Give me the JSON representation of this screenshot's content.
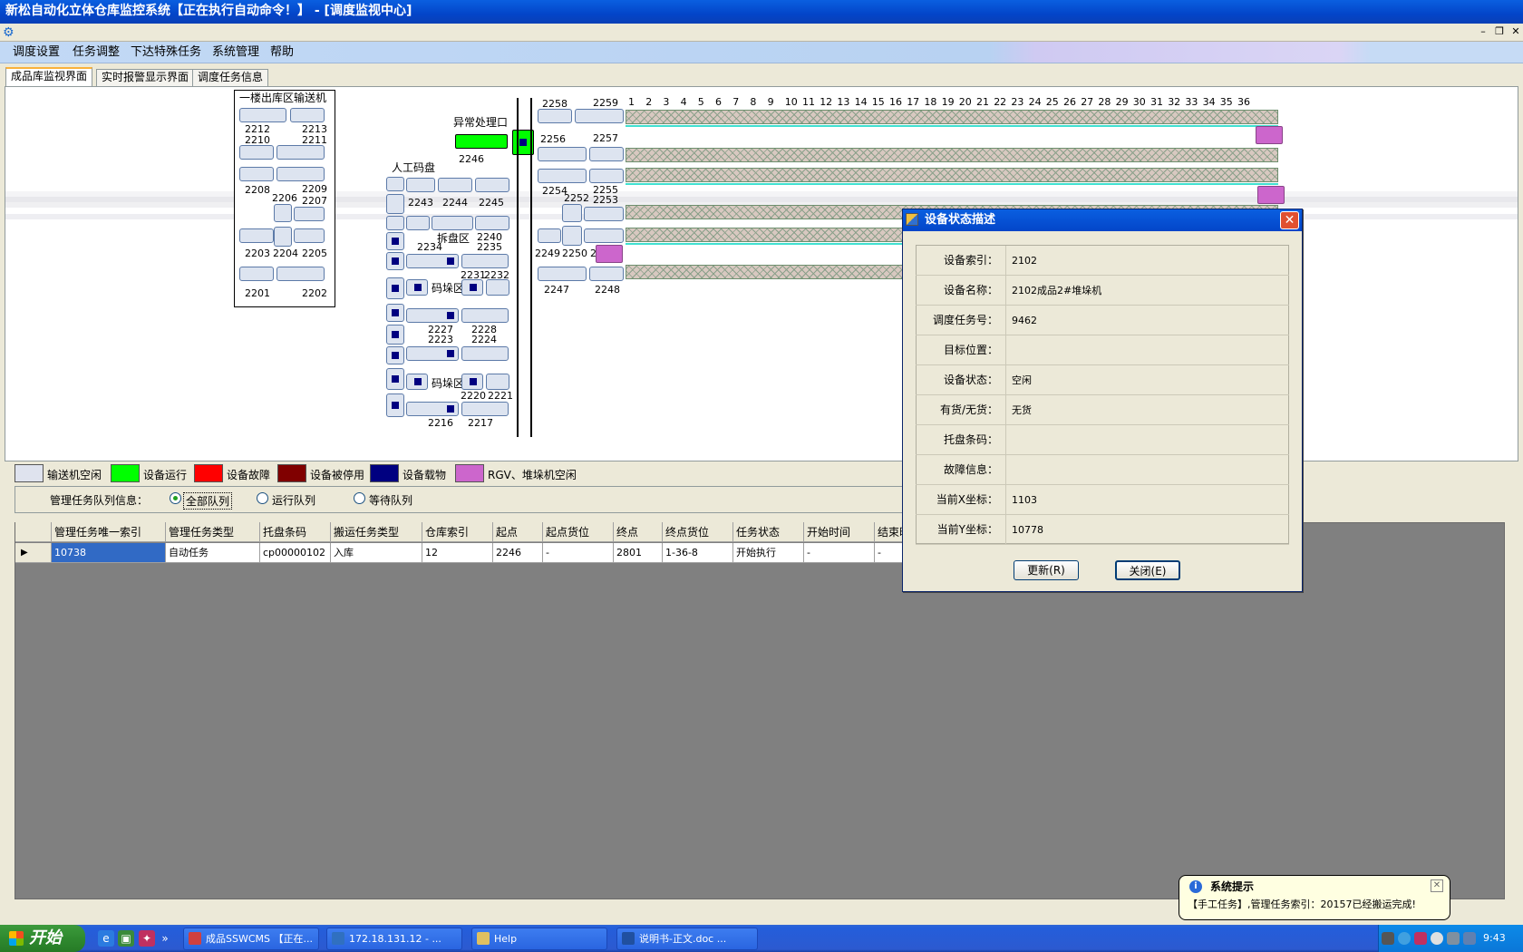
{
  "window": {
    "title": "新松自动化立体仓库监控系统【正在执行自动命令！】 - [调度监视中心]",
    "minimize_glyph": "–",
    "restore_glyph": "❐",
    "close_glyph": "✕"
  },
  "menu": [
    "调度设置",
    "任务调整",
    "下达特殊任务",
    "系统管理",
    "帮助"
  ],
  "tabs": [
    "成品库监视界面",
    "实时报警显示界面",
    "调度任务信息"
  ],
  "active_tab": 0,
  "monitor": {
    "conveyor_panel_title": "一楼出库区输送机",
    "left_labels": [
      "2212",
      "2213",
      "2210",
      "2211",
      "2208",
      "2209",
      "2206",
      "2207",
      "2203",
      "2204",
      "2205",
      "2201",
      "2202"
    ],
    "abnormal_port_title": "异常处理口",
    "abnormal_port_id": "2246",
    "manual_pallet_title": "人工码盘",
    "mid_labels": [
      "2243",
      "2244",
      "2245",
      "2234",
      "2240",
      "2235",
      "2231",
      "2232",
      "2227",
      "2228",
      "2223",
      "2224",
      "2220",
      "2221",
      "2216",
      "2217"
    ],
    "zone_unstack": "拆盘区",
    "zone_stack_1": "码垛区",
    "zone_stack_2": "码垛区",
    "right_labels": [
      "2258",
      "2259",
      "2256",
      "2257",
      "2254",
      "2255",
      "2253",
      "2252",
      "2249",
      "2250",
      "2",
      "2247",
      "2248"
    ],
    "columns": [
      "1",
      "2",
      "3",
      "4",
      "5",
      "6",
      "7",
      "8",
      "9",
      "10",
      "11",
      "12",
      "13",
      "14",
      "15",
      "16",
      "17",
      "18",
      "19",
      "20",
      "21",
      "22",
      "23",
      "24",
      "25",
      "26",
      "27",
      "28",
      "29",
      "30",
      "31",
      "32",
      "33",
      "34",
      "35",
      "36"
    ]
  },
  "legend": [
    {
      "label": "输送机空闲",
      "color": "#dfe3ee"
    },
    {
      "label": "设备运行",
      "color": "#00ff00"
    },
    {
      "label": "设备故障",
      "color": "#ff0000"
    },
    {
      "label": "设备被停用",
      "color": "#800000"
    },
    {
      "label": "设备载物",
      "color": "#000080"
    },
    {
      "label": "RGV、堆垛机空闲",
      "color": "#cc66cc"
    }
  ],
  "queue": {
    "label": "管理任务队列信息：",
    "options": [
      "全部队列",
      "运行队列",
      "等待队列"
    ],
    "selected": 0
  },
  "grid": {
    "headers": [
      "管理任务唯一索引",
      "管理任务类型",
      "托盘条码",
      "搬运任务类型",
      "仓库索引",
      "起点",
      "起点货位",
      "终点",
      "终点货位",
      "任务状态",
      "开始时间",
      "结束时"
    ],
    "rows": [
      [
        "10738",
        "自动任务",
        "cp00000102",
        "入库",
        "12",
        "2246",
        "-",
        "2801",
        "1-36-8",
        "开始执行",
        "-",
        "-"
      ]
    ],
    "row_marker": "▶"
  },
  "dialog": {
    "title": "设备状态描述",
    "fields": [
      {
        "key": "设备索引：",
        "value": "2102"
      },
      {
        "key": "设备名称：",
        "value": "2102成品2#堆垛机"
      },
      {
        "key": "调度任务号：",
        "value": "9462"
      },
      {
        "key": "目标位置：",
        "value": ""
      },
      {
        "key": "设备状态：",
        "value": "空闲"
      },
      {
        "key": "有货/无货：",
        "value": "无货"
      },
      {
        "key": "托盘条码：",
        "value": ""
      },
      {
        "key": "故障信息：",
        "value": ""
      },
      {
        "key": "当前X坐标：",
        "value": "1103"
      },
      {
        "key": "当前Y坐标：",
        "value": "10778"
      }
    ],
    "update_button": "更新(R)",
    "close_button": "关闭(E)"
  },
  "balloon": {
    "title": "系统提示",
    "text": "【手工任务】,管理任务索引：20157已经搬运完成!",
    "info_glyph": "i",
    "close_glyph": "✕"
  },
  "taskbar": {
    "start": "开始",
    "buttons": [
      "成品SSWCMS 【正在...",
      "172.18.131.12 - ...",
      "Help",
      "说明书-正文.doc ..."
    ],
    "clock": "9:43",
    "overflow": "»"
  }
}
